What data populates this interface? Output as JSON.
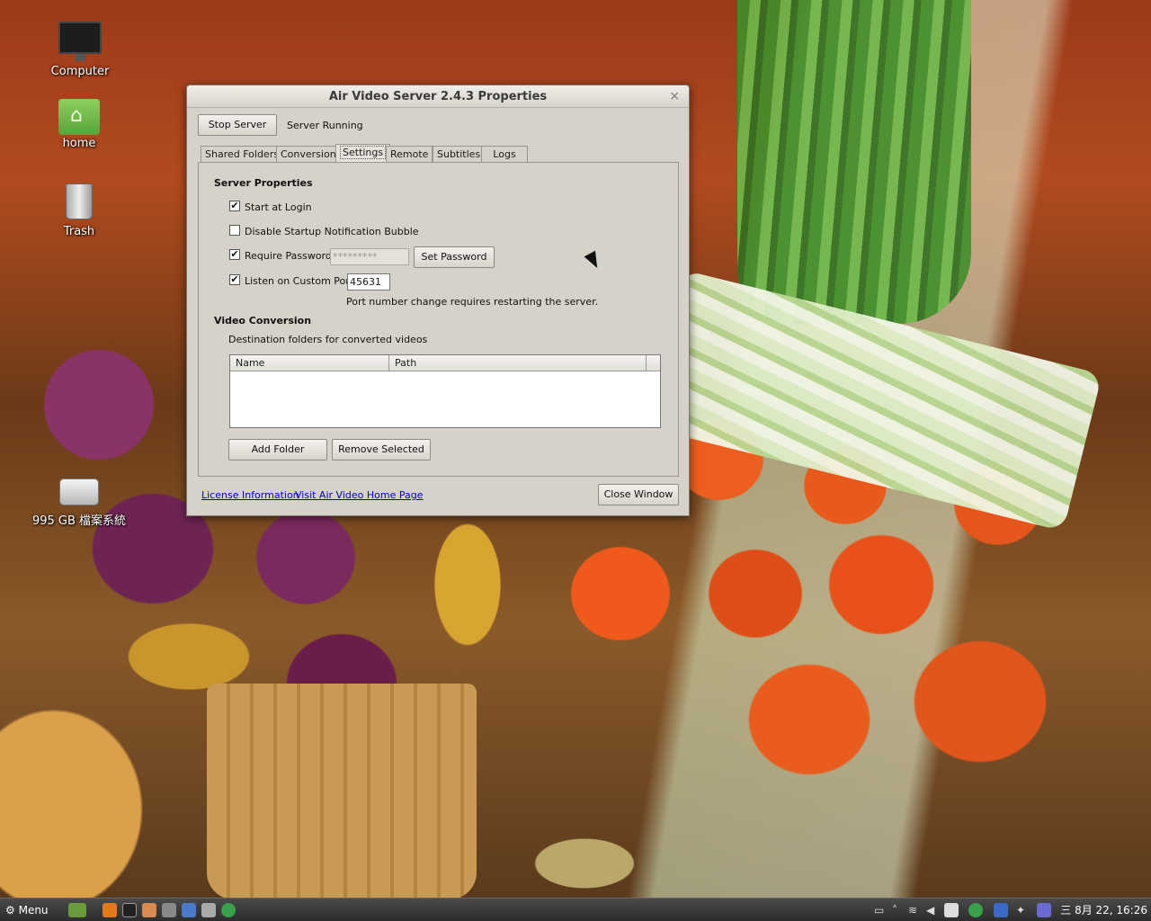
{
  "desktop": {
    "icons": [
      {
        "label": "Computer",
        "icon": "computer-icon"
      },
      {
        "label": "home",
        "icon": "home-folder-icon"
      },
      {
        "label": "Trash",
        "icon": "trash-icon"
      },
      {
        "label": "995 GB 檔案系統",
        "icon": "drive-icon"
      }
    ]
  },
  "dialog": {
    "title": "Air Video Server 2.4.3 Properties",
    "close_glyph": "×",
    "stop_button": "Stop Server",
    "status": "Server Running",
    "tabs": [
      {
        "label": "Shared Folders"
      },
      {
        "label": "Conversion"
      },
      {
        "label": "Settings",
        "active": true
      },
      {
        "label": "Remote"
      },
      {
        "label": "Subtitles"
      },
      {
        "label": "Logs"
      }
    ],
    "settings": {
      "server_properties_heading": "Server Properties",
      "start_at_login": {
        "label": "Start at Login",
        "checked": true
      },
      "disable_bubble": {
        "label": "Disable Startup Notification Bubble",
        "checked": false
      },
      "require_password": {
        "label": "Require Password",
        "checked": true,
        "password_mask": "*********"
      },
      "set_password_button": "Set Password",
      "custom_port": {
        "label": "Listen on Custom Port",
        "checked": true,
        "value": "45631"
      },
      "port_note": "Port number change requires restarting the server.",
      "video_conversion_heading": "Video Conversion",
      "destination_label": "Destination folders for converted videos",
      "table_columns": [
        "Name",
        "Path"
      ],
      "add_folder_button": "Add Folder",
      "remove_selected_button": "Remove Selected"
    },
    "footer": {
      "license_link": "License Information",
      "home_link": "Visit Air Video Home Page",
      "close_button": "Close Window"
    }
  },
  "taskbar": {
    "menu_label": "Menu",
    "clock": "三 8月 22, 16:26"
  }
}
